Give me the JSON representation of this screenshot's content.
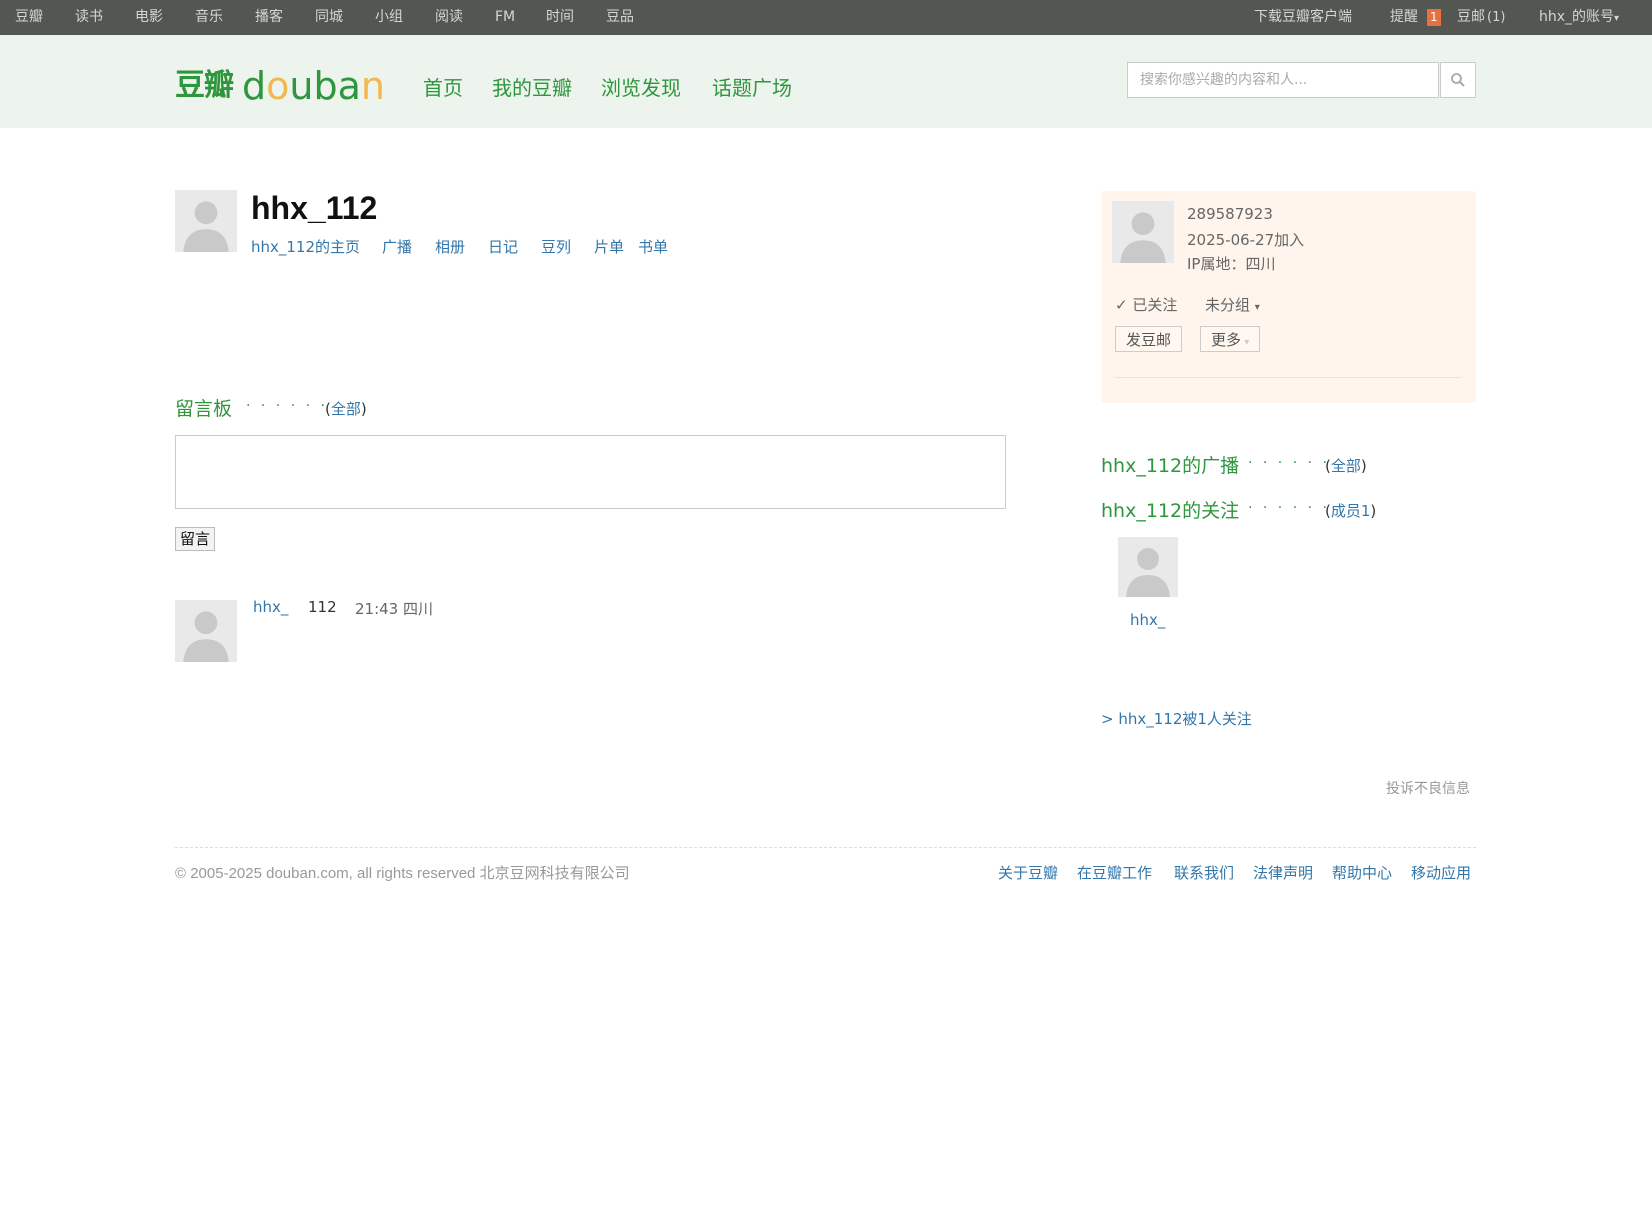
{
  "topbar": {
    "items": [
      "豆瓣",
      "读书",
      "电影",
      "音乐",
      "播客",
      "同城",
      "小组",
      "阅读",
      "FM",
      "时间",
      "豆品"
    ],
    "download": "下载豆瓣客户端",
    "remind": "提醒",
    "remind_count": "1",
    "mail": "豆邮",
    "mail_count": "(1)",
    "account": "hhx_的账号",
    "account_arrow": "▾"
  },
  "header": {
    "logo_cn": "豆瓣",
    "logo_en_1": "d",
    "logo_en_2": "o",
    "logo_en_3": "uba",
    "logo_en_4": "n",
    "nav": [
      "首页",
      "我的豆瓣",
      "浏览发现",
      "话题广场"
    ],
    "search_placeholder": "搜索你感兴趣的内容和人..."
  },
  "profile": {
    "name": "hhx_112",
    "tabs": [
      "hhx_112的主页",
      "广播",
      "相册",
      "日记",
      "豆列",
      "片单",
      "书单"
    ]
  },
  "messageboard": {
    "title": "留言板",
    "dots": "· · · · · ·",
    "all": "全部",
    "submit": "留言",
    "comment_user": "hhx_",
    "comment_text": "112",
    "comment_time": "21:43 四川"
  },
  "card": {
    "id": "289587923",
    "joined": "2025-06-27加入",
    "ip": "IP属地：四川",
    "followed": "✓ 已关注",
    "group": "未分组",
    "mail_btn": "发豆邮",
    "more_btn": "更多"
  },
  "sidebar": {
    "broadcast_title": "hhx_112的广播",
    "broadcast_all": "全部",
    "following_title": "hhx_112的关注",
    "following_members": "成员1",
    "dots": "· · · · · ·",
    "friend_name": "hhx_",
    "followers": "> hhx_112被1人关注",
    "report": "投诉不良信息"
  },
  "footer": {
    "copyright": "© 2005-2025 douban.com, all rights reserved 北京豆网科技有限公司",
    "links": [
      "关于豆瓣",
      "在豆瓣工作",
      "联系我们",
      "法律声明",
      "帮助中心",
      "移动应用"
    ]
  },
  "colors": {
    "brand_green": "#2e963d",
    "link_blue": "#3377aa",
    "topbar_bg": "#545652"
  }
}
